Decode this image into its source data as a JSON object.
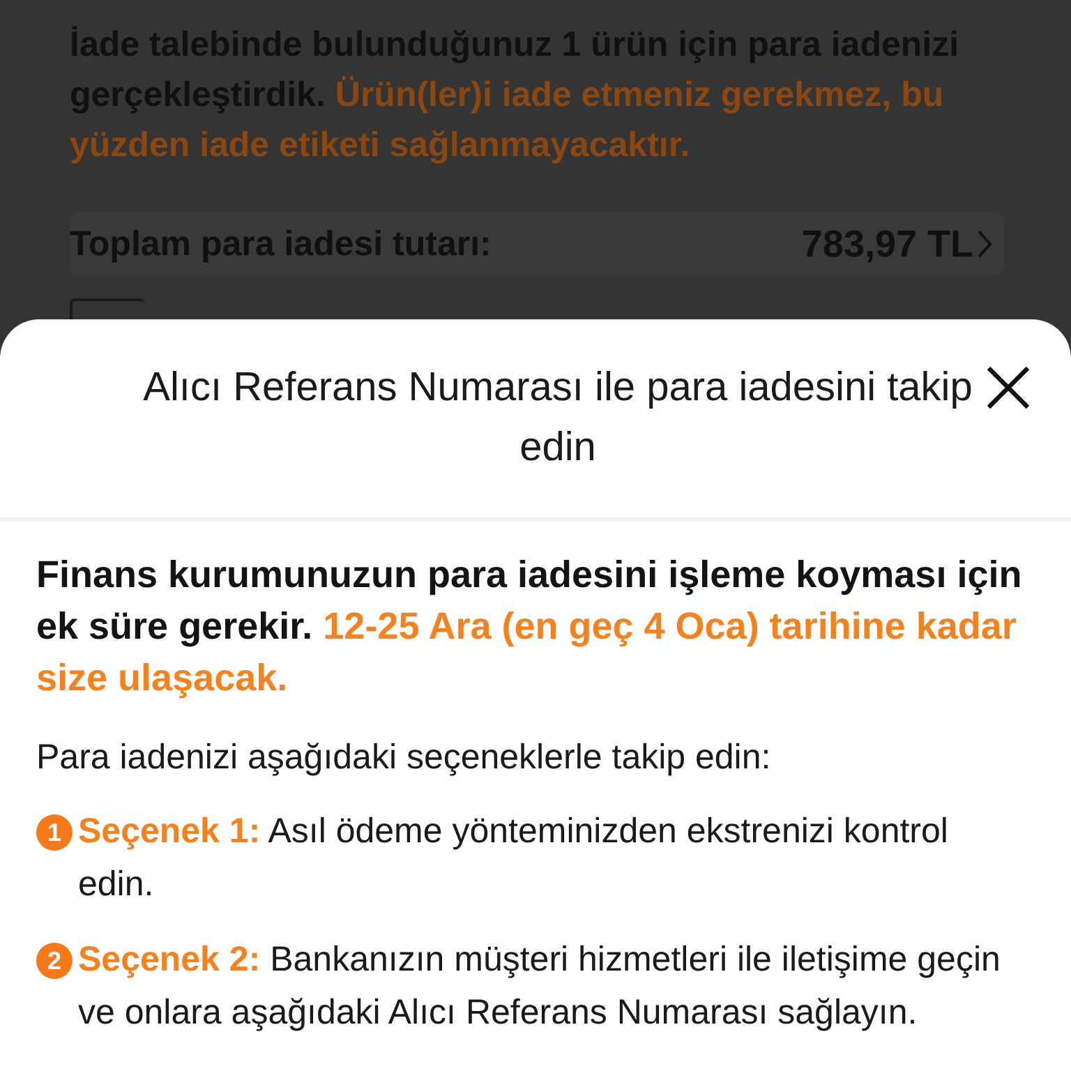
{
  "background": {
    "message": {
      "text": "İade talebinde bulunduğunuz 1 ürün için para iadenizi gerçekleştirdik.",
      "highlight": "Ürün(ler)i iade etmeniz gerekmez, bu yüzden iade etiketi sağlanmayacaktır."
    },
    "total": {
      "label": "Toplam para iadesi tutarı:",
      "amount": "783,97 TL"
    }
  },
  "sheet": {
    "title": "Alıcı Referans Numarası ile para iadesini takip edin",
    "notice": {
      "text": "Finans kurumunuzun para iadesini işleme koyması için ek süre gerekir.",
      "highlight": "12-25 Ara (en geç 4 Oca) tarihine kadar size ulaşacak."
    },
    "intro": "Para iadenizi aşağıdaki seçeneklerle takip edin:",
    "options": [
      {
        "number": "1",
        "label": "Seçenek 1:",
        "text": "Asıl ödeme yönteminizden ekstrenizi kontrol edin."
      },
      {
        "number": "2",
        "label": "Seçenek 2:",
        "text": "Bankanızın müşteri hizmetleri ile iletişime geçin ve onlara aşağıdaki Alıcı Referans Numarası sağlayın."
      }
    ]
  }
}
